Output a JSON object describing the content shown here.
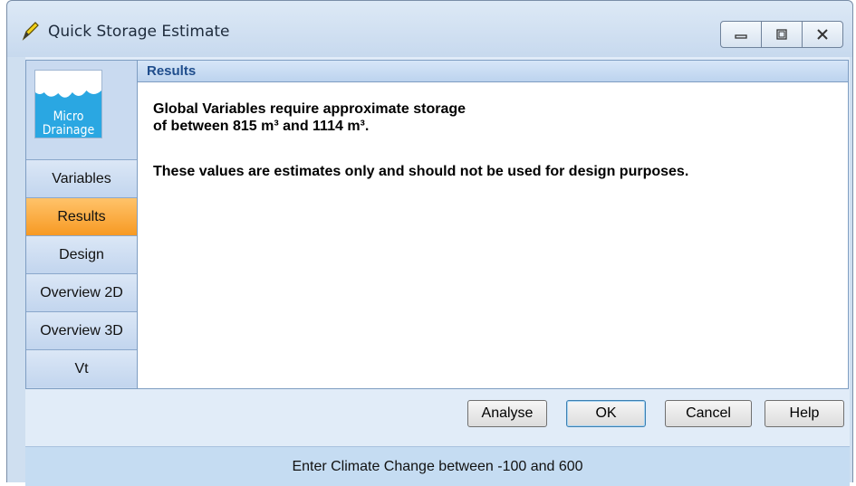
{
  "window": {
    "title": "Quick Storage Estimate",
    "controls": [
      "minimize-icon",
      "maximize-icon",
      "close-icon"
    ]
  },
  "logo": {
    "line1": "Micro",
    "line2": "Drainage"
  },
  "sidebar": {
    "items": [
      {
        "label": "Variables",
        "active": false
      },
      {
        "label": "Results",
        "active": true
      },
      {
        "label": "Design",
        "active": false
      },
      {
        "label": "Overview 2D",
        "active": false
      },
      {
        "label": "Overview 3D",
        "active": false
      },
      {
        "label": "Vt",
        "active": false
      }
    ]
  },
  "results": {
    "header": "Results",
    "line1": "Global Variables require approximate storage",
    "line2": "of between 815 m³ and 1114 m³.",
    "line3": "These values are estimates only and should not be used for design purposes."
  },
  "buttons": {
    "analyse": "Analyse",
    "ok": "OK",
    "cancel": "Cancel",
    "help": "Help"
  },
  "status": {
    "text": "Enter Climate Change between -100 and 600"
  },
  "colors": {
    "active_tab": "#f79a23",
    "header_text": "#1f4d8c",
    "logo_blue": "#2aa7e2"
  }
}
